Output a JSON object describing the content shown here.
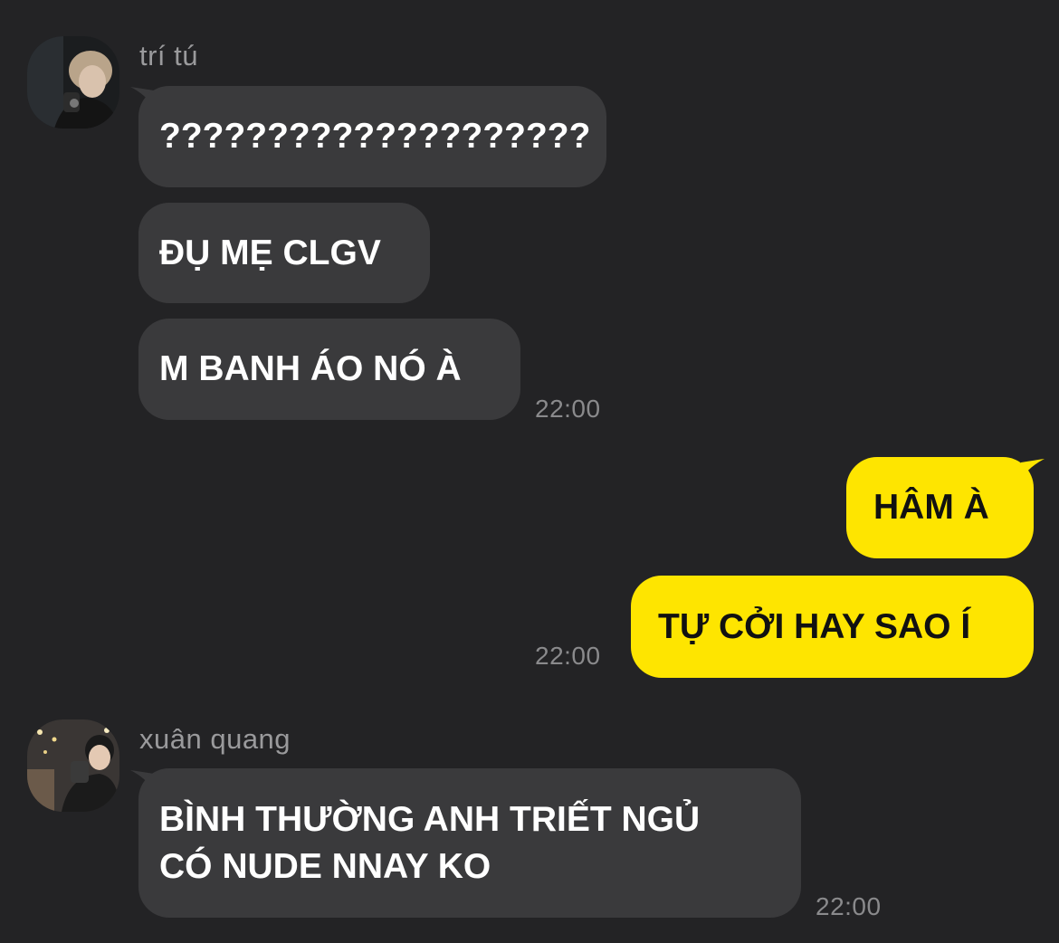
{
  "chat": {
    "groups": [
      {
        "sender": "trí tú",
        "avatar_icon": "user-photo-avatar",
        "messages": [
          "????????????????????",
          "ĐỤ MẸ CLGV",
          "M BANH ÁO NÓ À"
        ],
        "time": "22:00"
      },
      {
        "sender": "me",
        "messages": [
          "HÂM À",
          "TỰ CỞI HAY SAO Í"
        ],
        "time": "22:00"
      },
      {
        "sender": "xuân quang",
        "avatar_icon": "user-photo-avatar",
        "messages": [
          "BÌNH THƯỜNG ANH TRIẾT NGỦ\nCÓ NUDE NNAY KO"
        ],
        "time": "22:00"
      }
    ]
  },
  "colors": {
    "background": "#232325",
    "incoming_bubble": "#3a3a3c",
    "outgoing_bubble": "#fee500",
    "name_text": "#9a9a9c",
    "time_text": "#8a8a8c"
  }
}
